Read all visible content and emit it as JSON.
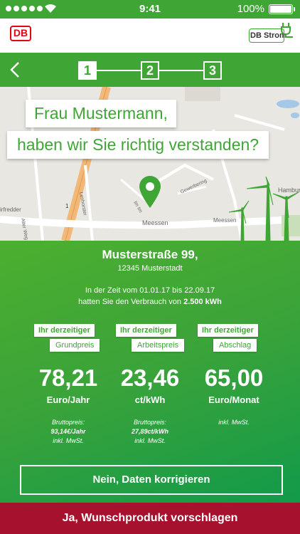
{
  "status": {
    "time": "9:41",
    "battery": "100%"
  },
  "header": {
    "logo": "DB",
    "brand": "DB Strom"
  },
  "steps": [
    "1",
    "2",
    "3"
  ],
  "map": {
    "greeting": "Frau Mustermann,",
    "question": "haben wir Sie richtig verstanden?",
    "labels": {
      "road_meessen": "Meessen",
      "place_hamburg": "Hamburg-",
      "road_left1": "Hoppen",
      "road_left2": "Heeweg",
      "road_left3": "Alter Weg",
      "road_a1": "1",
      "road_gerwerbering": "Gewerbering",
      "road_meessen2": "Meessen",
      "road_edder": "irfredder",
      "road_lenhorst": "Lenhorster",
      "road_sub1": "Im Im",
      "road_sub2": "Bahn"
    }
  },
  "address": {
    "street": "Musterstraße 99,",
    "city": "12345 Musterstadt"
  },
  "period": {
    "line1": "In der Zeit vom 01.01.17 bis 22.09.17",
    "line2_prefix": "hatten Sie den Verbrauch von",
    "line2_value": "2.500 kWh"
  },
  "prices": [
    {
      "tag1": "Ihr derzeitiger",
      "tag2": "Grundpreis",
      "value": "78,21",
      "unit": "Euro/Jahr",
      "note1": "Bruttopreis:",
      "note2": "93,14€/Jahr",
      "note3": "inkl. MwSt."
    },
    {
      "tag1": "Ihr derzeitiger",
      "tag2": "Arbeitspreis",
      "value": "23,46",
      "unit": "ct/kWh",
      "note1": "Bruttopreis:",
      "note2": "27,89ct/kWh",
      "note3": "inkl. MwSt."
    },
    {
      "tag1": "Ihr derzeitiger",
      "tag2": "Abschlag",
      "value": "65,00",
      "unit": "Euro/Monat",
      "note1": "inkl. MwSt."
    }
  ],
  "buttons": {
    "correct": "Nein, Daten korrigieren",
    "propose": "Ja, Wunschprodukt vorschlagen"
  },
  "colors": {
    "green": "#3fa535",
    "red": "#a6122d"
  }
}
